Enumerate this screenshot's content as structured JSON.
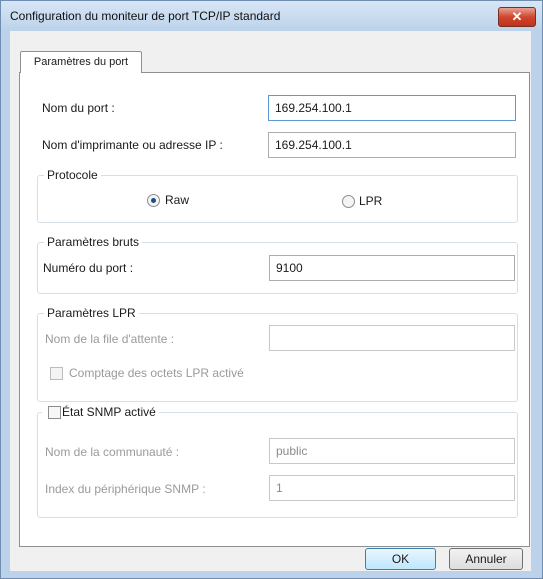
{
  "window": {
    "title": "Configuration du moniteur de port TCP/IP standard",
    "close_label": "✕"
  },
  "tabs": [
    {
      "label": "Paramètres du port"
    }
  ],
  "port": {
    "port_name_label": "Nom du port :",
    "port_name_value": "169.254.100.1",
    "printer_label": "Nom d'imprimante ou adresse IP :",
    "printer_value": "169.254.100.1"
  },
  "protocol": {
    "legend": "Protocole",
    "raw_label": "Raw",
    "lpr_label": "LPR",
    "selected": "Raw"
  },
  "raw_settings": {
    "legend": "Paramètres bruts",
    "port_number_label": "Numéro du port :",
    "port_number_value": "9100"
  },
  "lpr_settings": {
    "legend": "Paramètres LPR",
    "queue_label": "Nom de la file d'attente :",
    "queue_value": "",
    "byte_count_label": "Comptage des octets LPR activé"
  },
  "snmp": {
    "legend": "État SNMP activé",
    "community_label": "Nom de la communauté :",
    "community_value": "public",
    "index_label": "Index du périphérique SNMP :",
    "index_value": "1"
  },
  "buttons": {
    "ok_label": "OK",
    "cancel_label": "Annuler"
  }
}
